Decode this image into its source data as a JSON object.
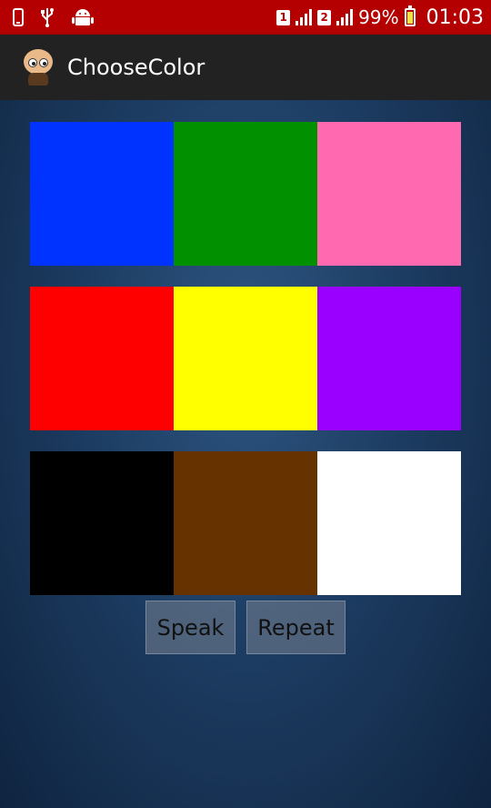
{
  "status_bar": {
    "battery_percent": "99%",
    "time": "01:03",
    "sim1": "1",
    "sim2": "2",
    "icons": [
      "phone-icon",
      "usb-icon",
      "android-icon"
    ],
    "battery_color": "#f2e24a",
    "bg_color": "#b40000"
  },
  "action_bar": {
    "title": "ChooseColor",
    "icon": "app-mascot-icon"
  },
  "color_grid": {
    "rows": [
      [
        "#0033ff",
        "#009000",
        "#ff69b0"
      ],
      [
        "#ff0000",
        "#ffff00",
        "#9900ff"
      ],
      [
        "#000000",
        "#663300",
        "#ffffff"
      ]
    ]
  },
  "buttons": {
    "speak": "Speak",
    "repeat": "Repeat"
  }
}
